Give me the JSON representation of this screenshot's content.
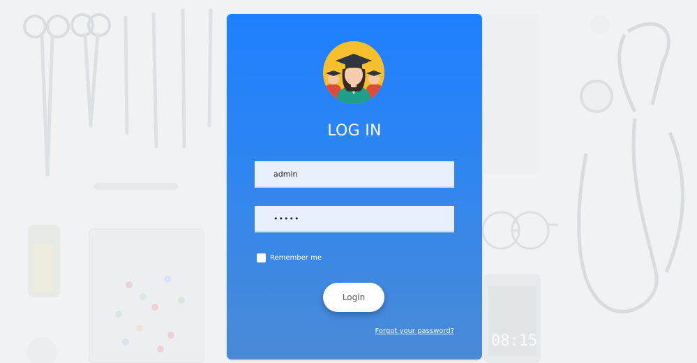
{
  "login": {
    "title": "LOG IN",
    "username_value": "admin",
    "password_value": "•••••",
    "remember_label": "Remember me",
    "login_label": "Login",
    "forgot_label": "Forgot your password?"
  },
  "background": {
    "clock_text": "08:15"
  },
  "colors": {
    "card_top": "#1e7fff",
    "card_bottom": "#4a8ad6",
    "field_bg": "#e8effd"
  }
}
